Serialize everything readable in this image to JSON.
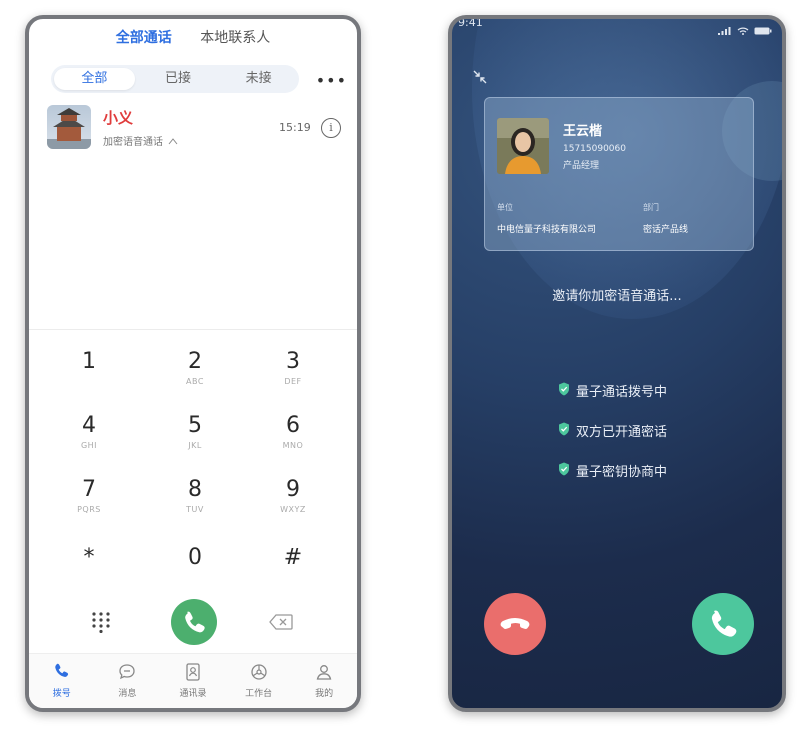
{
  "dialer": {
    "top_tabs": [
      "全部通话",
      "本地联系人"
    ],
    "filter_tabs": [
      "全部",
      "已接",
      "未接"
    ],
    "more_label": "•••",
    "call_log": [
      {
        "name": "小义",
        "subtitle": "加密语音通话",
        "time": "15:19"
      }
    ],
    "keys": [
      {
        "digit": "1",
        "letters": ""
      },
      {
        "digit": "2",
        "letters": "ABC"
      },
      {
        "digit": "3",
        "letters": "DEF"
      },
      {
        "digit": "4",
        "letters": "GHI"
      },
      {
        "digit": "5",
        "letters": "JKL"
      },
      {
        "digit": "6",
        "letters": "MNO"
      },
      {
        "digit": "7",
        "letters": "PQRS"
      },
      {
        "digit": "8",
        "letters": "TUV"
      },
      {
        "digit": "9",
        "letters": "WXYZ"
      },
      {
        "digit": "*",
        "letters": ""
      },
      {
        "digit": "0",
        "letters": ""
      },
      {
        "digit": "#",
        "letters": ""
      }
    ],
    "nav": [
      "拨号",
      "消息",
      "通讯录",
      "工作台",
      "我的"
    ],
    "colors": {
      "accent": "#2f6fe0",
      "call_green": "#4caf6e",
      "name_red": "#e03c3c"
    }
  },
  "incoming": {
    "status_time": "9:41",
    "caller": {
      "name": "王云楷",
      "phone": "15715090060",
      "title": "产品经理",
      "company_label": "单位",
      "company": "中电信量子科技有限公司",
      "dept_label": "部门",
      "dept": "密话产品线"
    },
    "invite_text": "邀请你加密语音通话...",
    "steps": [
      "量子通话拨号中",
      "双方已开通密话",
      "量子密钥协商中"
    ],
    "colors": {
      "hangup": "#ea6e6c",
      "answer": "#4dc79d",
      "check": "#4dc79d"
    }
  }
}
